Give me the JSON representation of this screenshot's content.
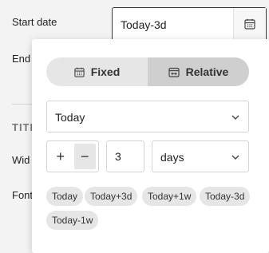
{
  "form": {
    "start_date_label": "Start date",
    "end_label": "End",
    "section_label": "TITL",
    "width_label": "Wid",
    "font_label": "Font"
  },
  "date_input": {
    "value": "Today-3d"
  },
  "popup": {
    "mode_fixed_label": "Fixed",
    "mode_relative_label": "Relative",
    "active_mode": "Relative",
    "base_select_value": "Today",
    "stepper_plus": "+",
    "stepper_minus": "−",
    "offset_value": "3",
    "unit_select_value": "days",
    "presets": [
      "Today",
      "Today+3d",
      "Today+1w",
      "Today-3d",
      "Today-1w"
    ]
  }
}
